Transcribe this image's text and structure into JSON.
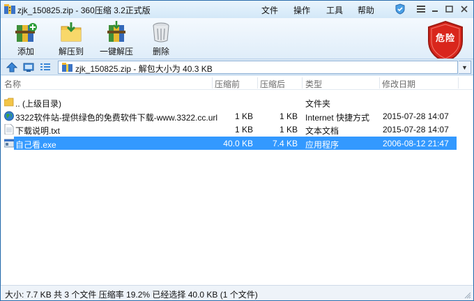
{
  "titlebar": {
    "title": "zjk_150825.zip - 360压缩 3.2正式版",
    "menus": [
      "文件",
      "操作",
      "工具",
      "帮助"
    ]
  },
  "toolbar": {
    "buttons": [
      {
        "label": "添加",
        "icon": "add-archive-icon"
      },
      {
        "label": "解压到",
        "icon": "extract-to-icon"
      },
      {
        "label": "一键解压",
        "icon": "one-click-extract-icon"
      },
      {
        "label": "删除",
        "icon": "delete-icon"
      }
    ],
    "danger_badge": "危险"
  },
  "address": {
    "path": "zjk_150825.zip - 解包大小为 40.3 KB"
  },
  "columns": [
    "名称",
    "压缩前",
    "压缩后",
    "类型",
    "修改日期"
  ],
  "files": [
    {
      "name": ".. (上级目录)",
      "original": "",
      "compressed": "",
      "type": "文件夹",
      "modified": "",
      "icon": "folder-icon"
    },
    {
      "name": "3322软件站-提供绿色的免费软件下载-www.3322.cc.url",
      "original": "1 KB",
      "compressed": "1 KB",
      "type": "Internet 快捷方式",
      "modified": "2015-07-28 14:07",
      "icon": "globe-icon"
    },
    {
      "name": "下载说明.txt",
      "original": "1 KB",
      "compressed": "1 KB",
      "type": "文本文档",
      "modified": "2015-07-28 14:07",
      "icon": "text-file-icon"
    },
    {
      "name": "自己看.exe",
      "original": "40.0 KB",
      "compressed": "7.4 KB",
      "type": "应用程序",
      "modified": "2006-08-12 21:47",
      "icon": "exe-icon",
      "selected": true
    }
  ],
  "status": "大小: 7.7 KB 共 3 个文件 压缩率 19.2% 已经选择 40.0 KB (1 个文件)",
  "colors": {
    "selection": "#3399ff",
    "danger_red": "#d9261c",
    "window_border": "#2a6cab"
  }
}
